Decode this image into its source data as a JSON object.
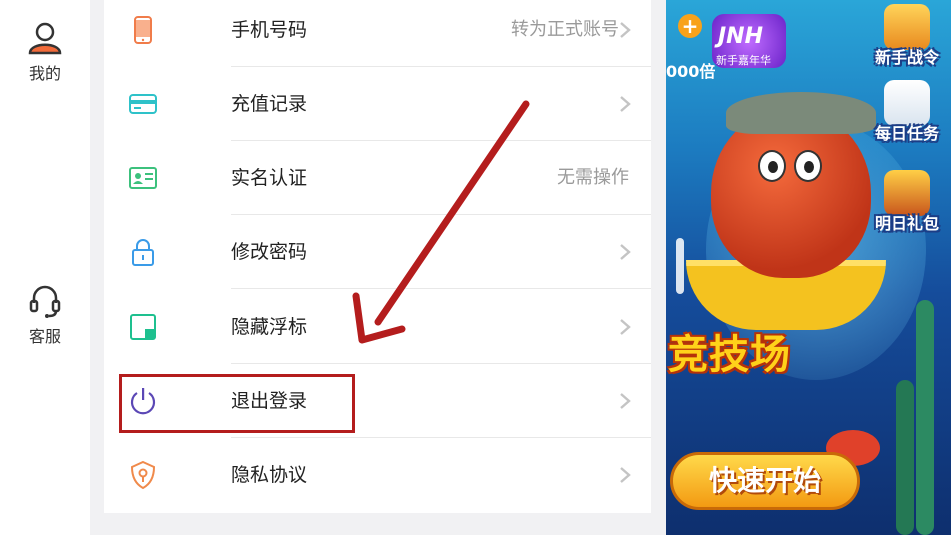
{
  "sidenav": {
    "items": [
      {
        "label": "我的",
        "icon": "user-icon"
      },
      {
        "label": "客服",
        "icon": "headset-icon"
      }
    ]
  },
  "settings": {
    "rows": [
      {
        "title": "手机号码",
        "value": "转为正式账号",
        "icon": "phone-icon",
        "icon_color": "#f07c4a",
        "chevron": true
      },
      {
        "title": "充值记录",
        "value": "",
        "icon": "card-icon",
        "icon_color": "#2ec2c9",
        "chevron": true
      },
      {
        "title": "实名认证",
        "value": "无需操作",
        "icon": "id-card-icon",
        "icon_color": "#3cc17d",
        "chevron": false
      },
      {
        "title": "修改密码",
        "value": "",
        "icon": "lock-icon",
        "icon_color": "#3a9be8",
        "chevron": true
      },
      {
        "title": "隐藏浮标",
        "value": "",
        "icon": "hide-float-icon",
        "icon_color": "#1ec08f",
        "chevron": true
      },
      {
        "title": "退出登录",
        "value": "",
        "icon": "power-icon",
        "icon_color": "#5b47b5",
        "chevron": true
      },
      {
        "title": "隐私协议",
        "value": "",
        "icon": "privacy-shield-icon",
        "icon_color": "#f08a4b",
        "chevron": true
      }
    ]
  },
  "annotation": {
    "highlight_color": "#b41d1d",
    "arrow_color": "#b41d1d"
  },
  "game": {
    "coin_text": "000倍",
    "logo_text": "JNH",
    "logo_sub": "新手嘉年华",
    "arena_title": "竞技场",
    "start_label": "快速开始",
    "side_buttons": [
      {
        "label": "新手战令",
        "icon": "gift-chest-icon"
      },
      {
        "label": "每日任务",
        "icon": "task-scroll-icon"
      },
      {
        "label": "明日礼包",
        "icon": "treasure-box-icon"
      }
    ]
  }
}
